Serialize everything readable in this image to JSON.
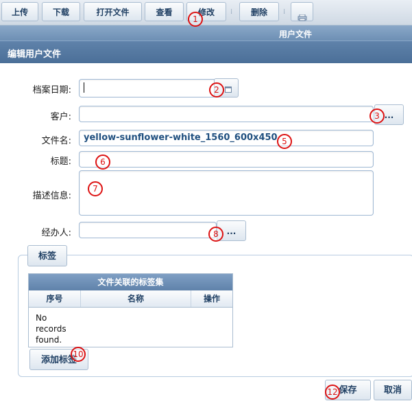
{
  "toolbar": {
    "upload": "上传",
    "download": "下载",
    "open_file": "打开文件",
    "view": "查看",
    "edit": "修改",
    "delete": "删除"
  },
  "panel_title": "用户文件",
  "form_title": "编辑用户文件",
  "fields": {
    "archive_date": {
      "label": "档案日期:",
      "value": ""
    },
    "customer": {
      "label": "客户:",
      "value": "",
      "button": "..."
    },
    "filename": {
      "label": "文件名:",
      "value": "yellow-sunflower-white_1560_600x450"
    },
    "title": {
      "label": "标题:",
      "value": ""
    },
    "description": {
      "label": "描述信息:",
      "value": ""
    },
    "handler": {
      "label": "经办人:",
      "value": "",
      "button": "..."
    }
  },
  "tags": {
    "legend": "标签",
    "grid_title": "文件关联的标签集",
    "columns": [
      "序号",
      "名称",
      "操作"
    ],
    "empty_text": "No records found.",
    "add_button": "添加标签"
  },
  "actions": {
    "save": "保存",
    "cancel": "取消"
  },
  "markers": [
    "1",
    "2",
    "3",
    "5",
    "6",
    "7",
    "8",
    "10",
    "12"
  ],
  "colors": {
    "accent": "#5f82aa",
    "marker": "#dd1111",
    "value_text": "#1f4f7f"
  },
  "icons": {
    "calendar": "calendar-icon",
    "print": "print-icon"
  }
}
